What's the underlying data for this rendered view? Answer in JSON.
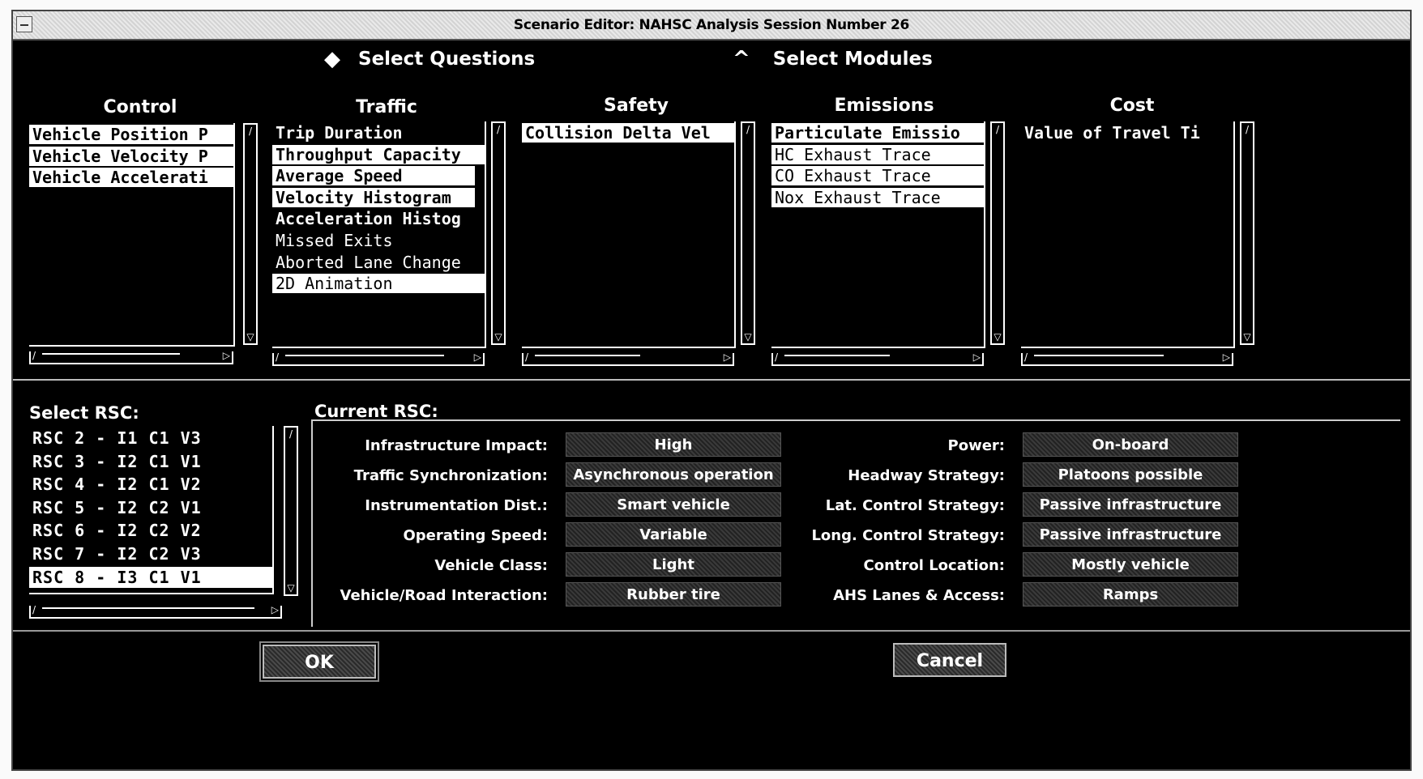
{
  "window": {
    "title": "Scenario Editor: NAHSC Analysis Session Number 26"
  },
  "modes": {
    "questions": {
      "label": "Select Questions",
      "icon": "filled-diamond-icon",
      "selected": true
    },
    "modules": {
      "label": "Select Modules",
      "icon": "hollow-diamond-icon",
      "selected": false
    }
  },
  "columns": [
    {
      "name": "Control",
      "items": [
        {
          "label": "Vehicle Position P",
          "selected": true
        },
        {
          "label": "Vehicle Velocity P",
          "selected": true
        },
        {
          "label": "Vehicle Accelerati",
          "selected": true
        }
      ]
    },
    {
      "name": "Traffic",
      "items": [
        {
          "label": "Trip Duration",
          "selected": false
        },
        {
          "label": "Throughput Capacity",
          "selected": true
        },
        {
          "label": "Average Speed",
          "selected": true
        },
        {
          "label": "Velocity Histogram",
          "selected": true
        },
        {
          "label": "Acceleration Histog",
          "selected": false
        },
        {
          "label": "Missed Exits",
          "selected": false
        },
        {
          "label": "Aborted Lane Change",
          "selected": false
        },
        {
          "label": "2D Animation",
          "selected": true
        }
      ]
    },
    {
      "name": "Safety",
      "items": [
        {
          "label": "Collision Delta Vel",
          "selected": true
        }
      ]
    },
    {
      "name": "Emissions",
      "items": [
        {
          "label": "Particulate Emissio",
          "selected": true
        },
        {
          "label": "HC Exhaust Trace",
          "selected": true
        },
        {
          "label": "CO Exhaust Trace",
          "selected": true
        },
        {
          "label": "Nox Exhaust Trace",
          "selected": true
        }
      ]
    },
    {
      "name": "Cost",
      "items": [
        {
          "label": "Value of Travel Ti",
          "selected": false
        }
      ]
    }
  ],
  "select_rsc": {
    "label": "Select RSC:",
    "items": [
      {
        "label": "RSC 2 - I1 C1 V3",
        "selected": false
      },
      {
        "label": "RSC 3 - I2 C1 V1",
        "selected": false
      },
      {
        "label": "RSC 4 - I2 C1 V2",
        "selected": false
      },
      {
        "label": "RSC 5 - I2 C2 V1",
        "selected": false
      },
      {
        "label": "RSC 6 - I2 C2 V2",
        "selected": false
      },
      {
        "label": "RSC 7 - I2 C2 V3",
        "selected": false
      },
      {
        "label": "RSC 8 - I3 C1 V1",
        "selected": true
      }
    ]
  },
  "current_rsc": {
    "label": "Current RSC:",
    "left": [
      {
        "label": "Infrastructure Impact:",
        "value": "High"
      },
      {
        "label": "Traffic Synchronization:",
        "value": "Asynchronous operation"
      },
      {
        "label": "Instrumentation Dist.:",
        "value": "Smart vehicle"
      },
      {
        "label": "Operating Speed:",
        "value": "Variable"
      },
      {
        "label": "Vehicle Class:",
        "value": "Light"
      },
      {
        "label": "Vehicle/Road Interaction:",
        "value": "Rubber tire"
      }
    ],
    "right": [
      {
        "label": "Power:",
        "value": "On-board"
      },
      {
        "label": "Headway Strategy:",
        "value": "Platoons possible"
      },
      {
        "label": "Lat. Control Strategy:",
        "value": "Passive infrastructure"
      },
      {
        "label": "Long. Control Strategy:",
        "value": "Passive infrastructure"
      },
      {
        "label": "Control Location:",
        "value": "Mostly vehicle"
      },
      {
        "label": "AHS Lanes & Access:",
        "value": "Ramps"
      }
    ]
  },
  "buttons": {
    "ok": "OK",
    "cancel": "Cancel"
  }
}
